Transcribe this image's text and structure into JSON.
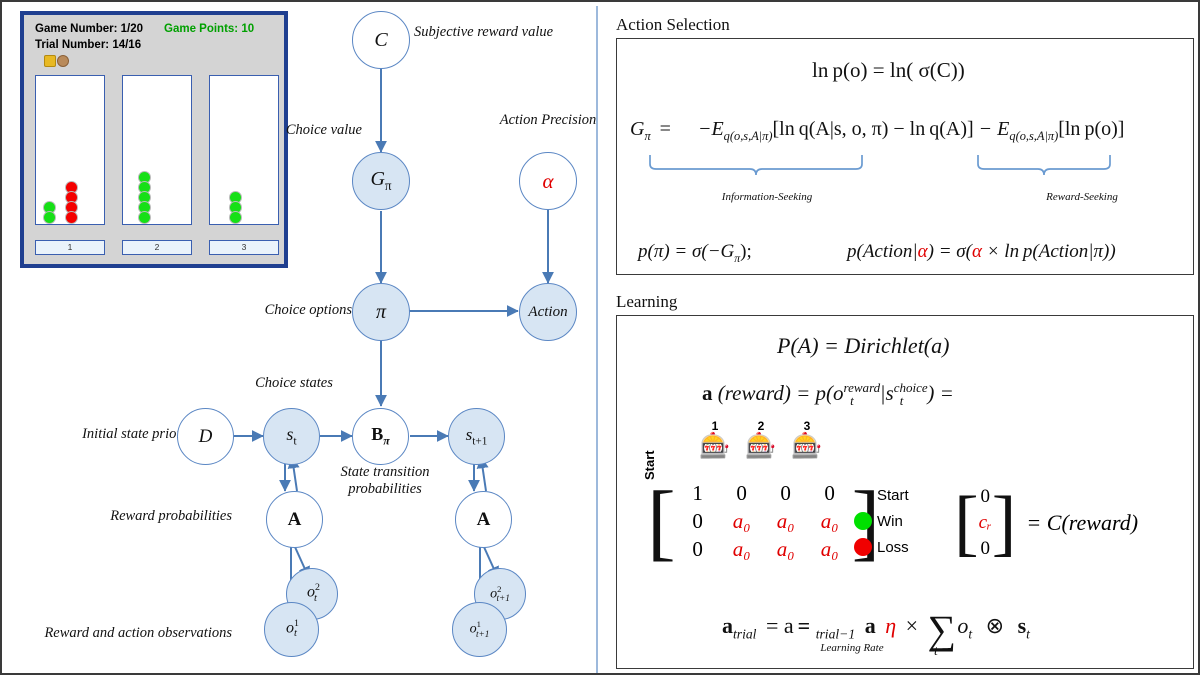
{
  "game_panel": {
    "game_number_label": "Game Number: 1/20",
    "game_points_label": "Game Points: 10",
    "trial_number_label": "Trial Number: 14/16",
    "columns": [
      {
        "button_label": "1",
        "green": 2,
        "red": 4
      },
      {
        "button_label": "2",
        "green": 5,
        "red": 0
      },
      {
        "button_label": "3",
        "green": 3,
        "red": 0
      }
    ]
  },
  "graph": {
    "labels": {
      "subjective_reward_value": "Subjective reward value",
      "choice_value": "Choice value",
      "action_precision": "Action Precision",
      "choice_options": "Choice options",
      "choice_states": "Choice states",
      "state_transition": "State transition probabilities",
      "initial_state_prior": "Initial state prior",
      "reward_probabilities": "Reward probabilities",
      "reward_and_action_observations": "Reward and action observations"
    },
    "nodes": {
      "C": "C",
      "G_pi": "G",
      "G_pi_sub": "π",
      "alpha": "α",
      "pi": "π",
      "action": "Action",
      "D": "D",
      "s_t": "s",
      "s_t_sub": "t",
      "B_pi": "B",
      "B_pi_sub": "π",
      "s_t1": "s",
      "s_t1_sub": "t+1",
      "A": "A",
      "A2": "A",
      "o2_t": "o",
      "o2_t_sup": "2",
      "o2_t_sub": "t",
      "o1_t": "o",
      "o1_t_sup": "1",
      "o1_t_sub": "t",
      "o2_t1": "o",
      "o2_t1_sup": "2",
      "o2_t1_sub": "t+1",
      "o1_t1": "o",
      "o1_t1_sup": "1",
      "o1_t1_sub": "t+1"
    }
  },
  "action_selection": {
    "title": "Action Selection",
    "eq_lnp": "ln p(o) = ln( σ(C))",
    "eq_G_lhs": "G",
    "eq_G_lhs_sub": "π",
    "eq_G_eq": "=",
    "eq_G_term1": "−E",
    "eq_G_term1_sub": "q(o,s,A|π)",
    "eq_G_term1_body": "[ln q(A|s, o, π) − ln q(A)]",
    "eq_G_term2": "− E",
    "eq_G_term2_sub": "q(o,s,A|π)",
    "eq_G_term2_body": "[ln p(o)]",
    "caption_info": "Information-Seeking",
    "caption_reward": "Reward-Seeking",
    "eq_ppi": "p(π) = σ(−G",
    "eq_ppi_sub": "π",
    "eq_ppi_end": ");",
    "eq_paction_a": "p(Action|",
    "eq_paction_alpha": "α",
    "eq_paction_b": ") =  σ(",
    "eq_paction_alpha2": "α",
    "eq_paction_c": " × ln p(Action|π))"
  },
  "learning": {
    "title": "Learning",
    "eq_dirichlet": "P(A) = Dirichlet(a)",
    "eq_a_reward_lhs": "a",
    "eq_a_reward_mid": " (reward) = p(o",
    "eq_a_reward_sup": "reward",
    "eq_a_reward_sub": "t",
    "eq_a_reward_bar": "|s",
    "eq_a_reward_sup2": "choice",
    "eq_a_reward_sub2": "t",
    "eq_a_reward_end": ") =",
    "start_vertical": "Start",
    "slot_icon": "slot-machine-icon",
    "column_numbers": [
      "1",
      "2",
      "3"
    ],
    "matrix_rows": [
      [
        "1",
        "0",
        "0",
        "0"
      ],
      [
        "0",
        "a₀",
        "a₀",
        "a₀"
      ],
      [
        "0",
        "a₀",
        "a₀",
        "a₀"
      ]
    ],
    "row_legend": [
      "Start",
      "Win",
      "Loss"
    ],
    "win_color": "#00e000",
    "loss_color": "#f00000",
    "c_vector": [
      "0",
      "cᵣ",
      "0"
    ],
    "c_vector_eq": "= C(reward)",
    "eq_atrial_lhs": "a",
    "eq_atrial_lhs_sub": "trial",
    "eq_atrial_eq": "=  a",
    "eq_atrial_prev_sub": "trial−1",
    "eq_atrial_plus": "+",
    "eq_atrial_eta": "η",
    "eq_atrial_times": "×",
    "eq_atrial_sum": "∑",
    "eq_atrial_sum_sub": "t",
    "eq_atrial_o": "o",
    "eq_atrial_o_sub": "t",
    "eq_atrial_otimes": "⊗",
    "eq_atrial_s": "s",
    "eq_atrial_s_sub": "t",
    "caption_learning_rate": "Learning Rate"
  },
  "colors": {
    "node_fill": "#d7e5f3",
    "node_stroke": "#5b87c4",
    "accent_red": "#e00000",
    "panel_border": "#1f3f90",
    "divider": "#9db9dc"
  }
}
